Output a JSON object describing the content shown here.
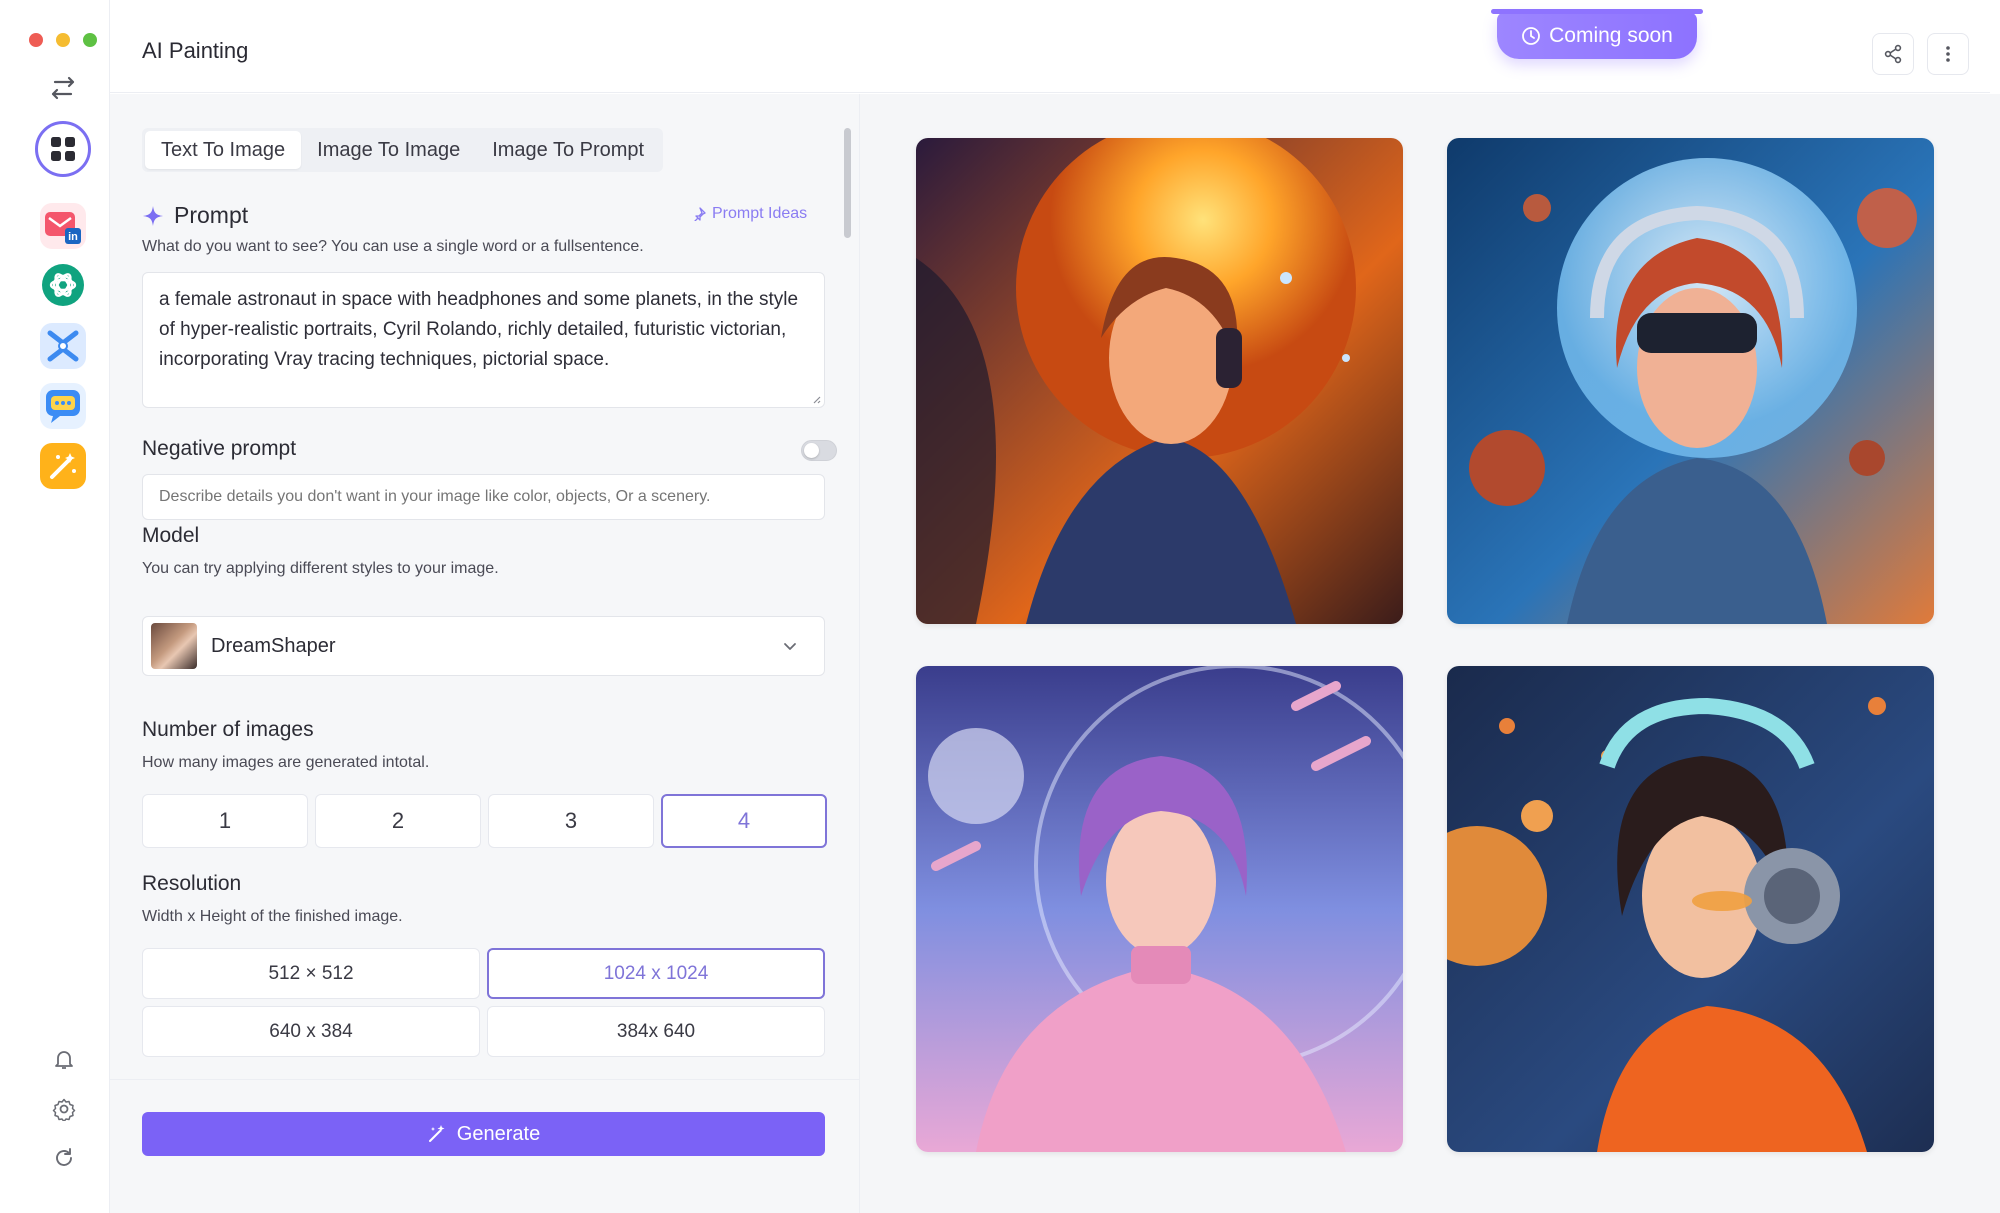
{
  "window": {
    "controls": [
      "close",
      "minimize",
      "maximize"
    ]
  },
  "header": {
    "title": "AI Painting",
    "coming_soon": "Coming soon"
  },
  "rail": {
    "apps": [
      "grid-icon",
      "mail-linkedin-icon",
      "openai-icon",
      "claw-icon",
      "chat-icon",
      "magic-wand-icon"
    ],
    "bottom": [
      "bell-icon",
      "gear-icon",
      "refresh-icon"
    ]
  },
  "tabs": [
    {
      "label": "Text To Image",
      "active": true
    },
    {
      "label": "Image To Image",
      "active": false
    },
    {
      "label": "Image To Prompt",
      "active": false
    }
  ],
  "prompt": {
    "title": "Prompt",
    "ideas_label": "Prompt Ideas",
    "description": "What do you want to see? You can use a single word or a fullsentence.",
    "value": "a female astronaut in space with headphones and some planets, in the style of hyper-realistic portraits, Cyril Rolando, richly detailed, futuristic victorian, incorporating Vray tracing techniques, pictorial space."
  },
  "negative_prompt": {
    "title": "Negative prompt",
    "enabled": false,
    "placeholder": "Describe details you don't want in your image like color, objects, Or a scenery."
  },
  "model": {
    "title": "Model",
    "description": "You can try applying different styles to your image.",
    "selected": "DreamShaper"
  },
  "num_images": {
    "title": "Number of images",
    "description": "How many images are generated intotal.",
    "options": [
      "1",
      "2",
      "3",
      "4"
    ],
    "selected": "4"
  },
  "resolution": {
    "title": "Resolution",
    "description": "Width x Height of the finished image.",
    "options": [
      "512 × 512",
      "1024 x 1024",
      "640 x 384",
      "384x 640"
    ],
    "selected": "1024 x 1024"
  },
  "generate_label": "Generate",
  "colors": {
    "accent": "#7b62f6",
    "accent_light": "#8d72ff",
    "selected_border": "#7f74d8"
  }
}
